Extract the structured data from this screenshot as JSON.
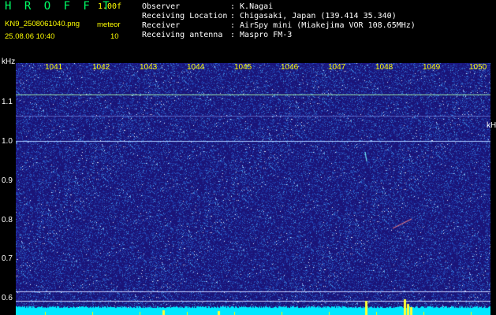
{
  "header": {
    "app_title": "H R O F F T",
    "version": "1.00f",
    "filename": "KN9_2508061040.png",
    "datetime": "25.08.06 10:40",
    "meteor_label": "meteor",
    "meteor_count": "10"
  },
  "info": [
    {
      "key": "Observer",
      "value": ": K.Nagai"
    },
    {
      "key": "Receiving Location",
      "value": ": Chigasaki, Japan (139.414 35.340)"
    },
    {
      "key": "Receiver",
      "value": ": AirSpy mini (Miakejima VOR 108.65MHz)"
    },
    {
      "key": "Receiving antenna",
      "value": ": Maspro FM-3"
    }
  ],
  "axis": {
    "unit_top": "kHz",
    "unit_side": "kHz",
    "time_labels": [
      "1041",
      "1042",
      "1043",
      "1044",
      "1045",
      "1046",
      "1047",
      "1048",
      "1049",
      "1050"
    ],
    "freq_labels": [
      "1.1",
      "1.0",
      "0.9",
      "0.8",
      "0.7",
      "0.6"
    ]
  },
  "colors": {
    "background": "#1a1478",
    "header_text": "#ffff00",
    "title_text": "#00ff66",
    "signal_line": "#7fffff"
  }
}
